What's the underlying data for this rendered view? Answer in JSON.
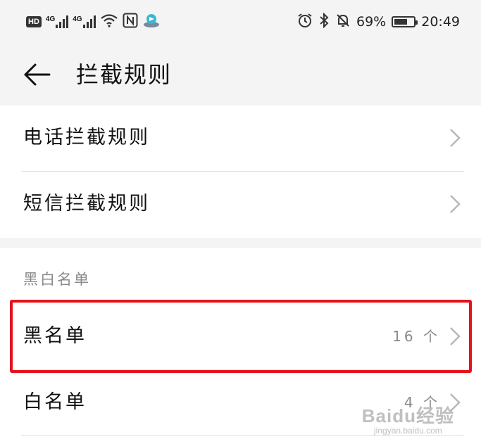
{
  "status_bar": {
    "hd_badge": "HD",
    "signal_1": "4G",
    "signal_2": "4G",
    "battery_percent": "69%",
    "battery_level": 0.69,
    "time": "20:49",
    "icons": [
      "wifi-icon",
      "nfc-icon",
      "app-notification-icon",
      "alarm-icon",
      "bluetooth-icon",
      "mute-icon"
    ]
  },
  "header": {
    "title": "拦截规则"
  },
  "rules": {
    "items": [
      {
        "label": "电话拦截规则"
      },
      {
        "label": "短信拦截规则"
      }
    ]
  },
  "lists": {
    "section_title": "黑白名单",
    "items": [
      {
        "label": "黑名单",
        "value": "16 个"
      },
      {
        "label": "白名单",
        "value": "4 个"
      }
    ]
  },
  "annotation": {
    "color": "#e4131b"
  },
  "watermark": {
    "logo": "Baidu经验",
    "url": "jingyan.baidu.com"
  },
  "colors": {
    "background": "#f4f4f4",
    "card": "#ffffff",
    "secondary_text": "#888888",
    "divider": "#e2e2e2"
  }
}
